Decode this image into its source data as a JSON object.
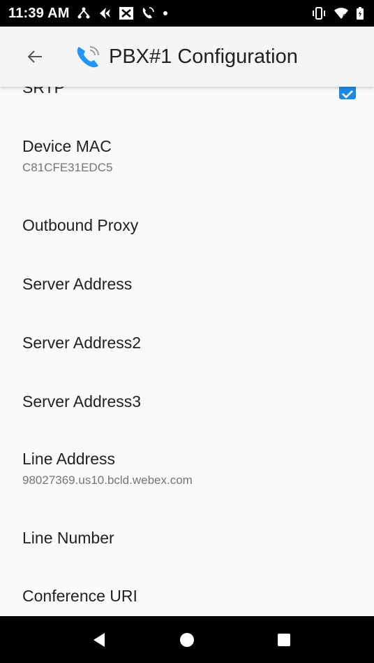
{
  "status_bar": {
    "time": "11:39 AM",
    "left_icons": [
      "network-tree-icon",
      "feather-icon",
      "message-x-icon",
      "phone-call-icon",
      "dot-icon"
    ],
    "right_icons": [
      "vibrate-icon",
      "wifi-icon",
      "battery-charging-icon"
    ]
  },
  "app_bar": {
    "back_icon": "arrow-back-icon",
    "app_icon": "phone-call-icon",
    "title": "PBX#1 Configuration"
  },
  "preferences": [
    {
      "title": "SRTP",
      "summary": "",
      "checkbox": true,
      "checked": true
    },
    {
      "title": "Device MAC",
      "summary": "C81CFE31EDC5"
    },
    {
      "title": "Outbound Proxy",
      "summary": ""
    },
    {
      "title": "Server Address",
      "summary": ""
    },
    {
      "title": "Server Address2",
      "summary": ""
    },
    {
      "title": "Server Address3",
      "summary": ""
    },
    {
      "title": "Line Address",
      "summary": "98027369.us10.bcld.webex.com"
    },
    {
      "title": "Line Number",
      "summary": ""
    },
    {
      "title": "Conference URI",
      "summary": ""
    }
  ],
  "nav_bar": {
    "back": "triangle-back-icon",
    "home": "circle-home-icon",
    "recents": "square-recents-icon"
  },
  "colors": {
    "accent": "#1e88e5",
    "app_icon": "#2196f3",
    "status_bar_bg": "#000000",
    "app_bar_bg": "#f5f5f5",
    "content_bg": "#fafafa"
  }
}
